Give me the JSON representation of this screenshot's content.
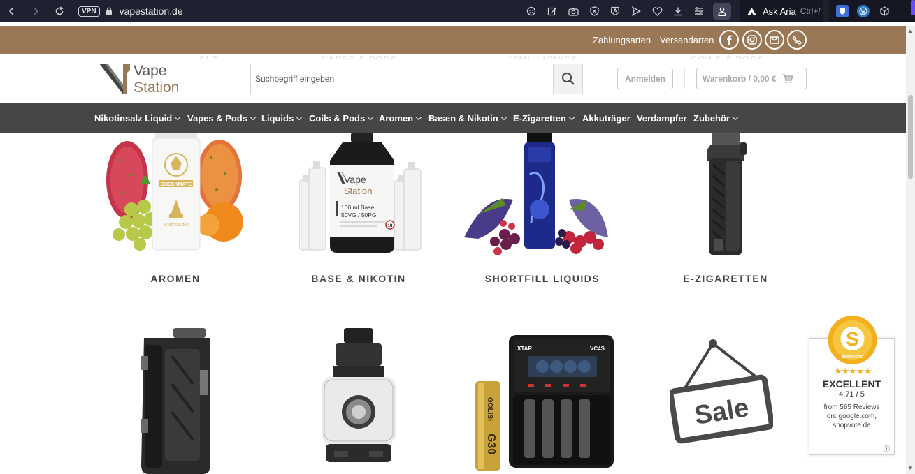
{
  "browser": {
    "back_icon": "chevron-left-icon",
    "vpn_label": "VPN",
    "url": "vapestation.de",
    "aria_label": "Ask Aria",
    "aria_shortcut": "Ctrl+/"
  },
  "topbar": {
    "payment_label": "Zahlungsarten",
    "shipping_label": "Versandarten"
  },
  "ghost_nav": [
    "ALZ",
    "VAPES & PODS",
    "10ML LIQUIDS",
    "COILS & PODS"
  ],
  "logo": {
    "line1": "Vape",
    "line2": "Station"
  },
  "search": {
    "placeholder": "Suchbegriff eingeben"
  },
  "header": {
    "login_label": "Anmelden",
    "cart_label": "Warenkorb / 0,00 €"
  },
  "main_nav": [
    {
      "label": "Nikotinsalz Liquid",
      "has_dropdown": true
    },
    {
      "label": "Vapes & Pods",
      "has_dropdown": true
    },
    {
      "label": "Liquids",
      "has_dropdown": true
    },
    {
      "label": "Coils & Pods",
      "has_dropdown": true
    },
    {
      "label": "Aromen",
      "has_dropdown": true
    },
    {
      "label": "Basen & Nikotin",
      "has_dropdown": true
    },
    {
      "label": "E-Zigaretten",
      "has_dropdown": true
    },
    {
      "label": "Akkuträger",
      "has_dropdown": false
    },
    {
      "label": "Verdampfer",
      "has_dropdown": false
    },
    {
      "label": "Zubehör",
      "has_dropdown": true
    }
  ],
  "categories": [
    {
      "label": "AROMEN"
    },
    {
      "label": "BASE & NIKOTIN"
    },
    {
      "label": "SHORTFILL LIQUIDS"
    },
    {
      "label": "E-ZIGARETTEN"
    }
  ],
  "product_texts": {
    "checkmate": "CHECKMATE",
    "white_king": "WHITE KING",
    "base_vape": "Vape",
    "base_station": "Station",
    "base_ml": "100 ml  Base",
    "base_ratio": "50VG / 50PG",
    "base_age": "18",
    "xtar": "XTAR",
    "vc4s": "VC4S",
    "golisi": "GOLISI",
    "g30": "G30",
    "sale": "Sale"
  },
  "badge": {
    "seal_text": "SHOPVOTE",
    "stars": "★★★★★",
    "rating_label": "EXCELLENT",
    "score": "4.71 / 5",
    "from_line1": "from 565 Reviews",
    "from_line2": "on: google.com,",
    "from_line3": "shopvote.de",
    "info": "ⓘ"
  },
  "colors": {
    "brand_brown": "#9a7856",
    "nav_dark": "#464646",
    "browser_dark": "#1f2130"
  }
}
